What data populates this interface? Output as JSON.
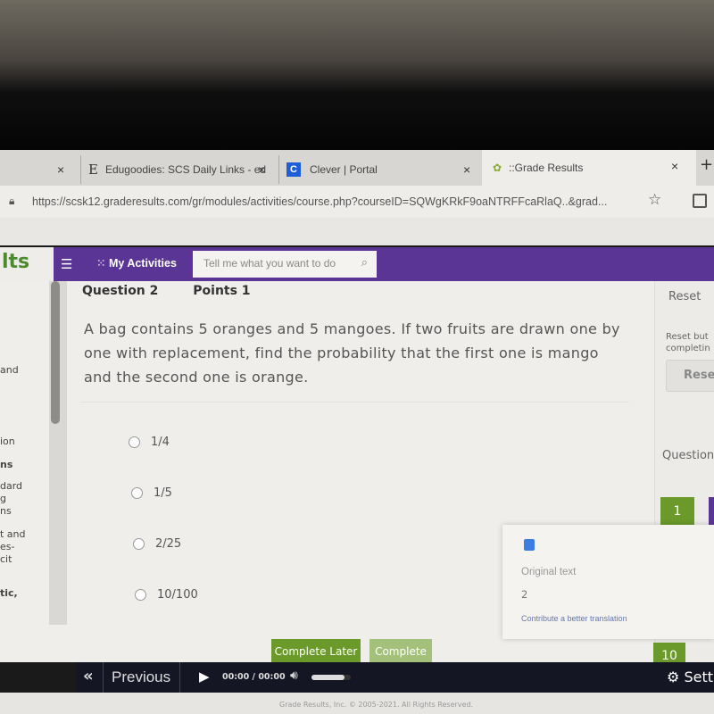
{
  "browser": {
    "tabs": [
      {
        "label": "Edugoodies: SCS Daily Links - ed",
        "icon": "E"
      },
      {
        "label": "Clever | Portal",
        "icon": "C"
      },
      {
        "label": "::Grade Results",
        "icon": "grade-results-icon"
      }
    ],
    "url": "https://scsk12.graderesults.com/gr/modules/activities/course.php?courseID=SQWgKRkF9oaNTRFFcaRlaQ..&grad..."
  },
  "nav": {
    "logo": "lts",
    "my_activities": "My Activities",
    "search_placeholder": "Tell me what you want to do"
  },
  "sidebar": {
    "fragments": [
      "and",
      "ion",
      "ns",
      "dard",
      "g",
      "ns",
      "t and",
      "es-",
      "cit",
      "tic,"
    ]
  },
  "question": {
    "number": "Question 2",
    "points": "Points 1",
    "text": "A bag contains 5 oranges and 5 mangoes. If two fruits are drawn one by one with replacement, find the probability that the first one is mango and the second one is orange.",
    "options": [
      "1/4",
      "1/5",
      "2/25",
      "10/100"
    ]
  },
  "right_panel": {
    "reset_title": "Reset",
    "reset_desc_1": "Reset but",
    "reset_desc_2": "completin",
    "reset_button": "Reset",
    "questions_title": "Questions",
    "q_buttons": [
      "1",
      "10"
    ]
  },
  "translate_popup": {
    "original_label": "Original text",
    "original_value": "2",
    "contribute": "Contribute a better translation"
  },
  "actions": {
    "complete_later": "Complete Later",
    "complete": "Complete"
  },
  "player": {
    "prev_icon": "«",
    "previous": "Previous",
    "time": "00:00 / 00:00",
    "settings": "Setti",
    "volume": 0.85
  },
  "footer": {
    "copyright": "Grade Results, Inc. © 2005-2021. All Rights Reserved."
  },
  "colors": {
    "purple": "#5b3596",
    "green": "#6b9a2a",
    "green_light": "#a3c17a",
    "dark_bar": "#141624"
  }
}
